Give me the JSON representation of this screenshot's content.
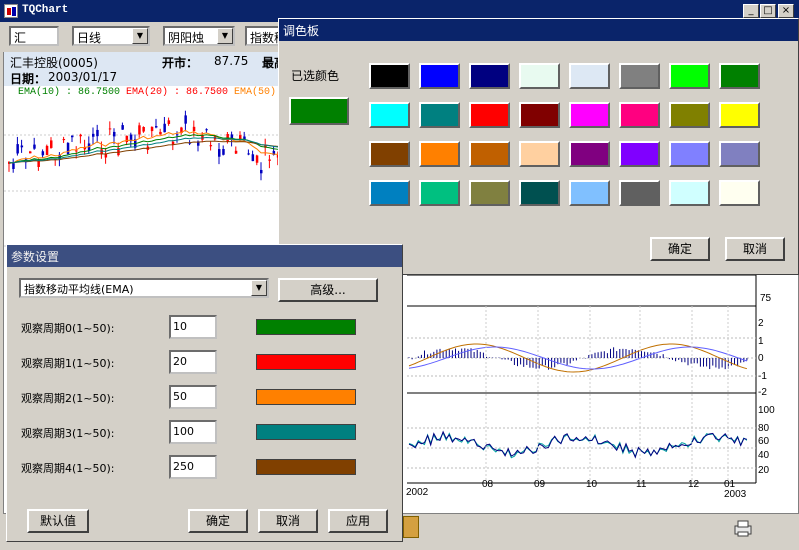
{
  "window": {
    "title": "TQChart",
    "min": "_",
    "max": "□",
    "close": "×"
  },
  "toolbar": {
    "code": "汇",
    "period": "日线",
    "style": "阴阳烛",
    "indicator": "指数移"
  },
  "info": {
    "stock": "汇丰控股(0005)",
    "open_label": "开市：",
    "open_value": "87.75",
    "high_label": "最高",
    "date_label": "日期：",
    "date_value": "2003/01/17",
    "ema10": "EMA(10) : 86.7500",
    "ema20": "EMA(20) : 86.7500",
    "ema50": "EMA(50)"
  },
  "axes": {
    "y_top_tick": "75",
    "macd_ticks": [
      "2",
      "1",
      "0",
      "-1",
      "-2"
    ],
    "osc_ticks": [
      "100",
      "80",
      "60",
      "40",
      "20"
    ],
    "x_labels": [
      "2002",
      "08",
      "09",
      "10",
      "11",
      "12",
      "01",
      "2003"
    ]
  },
  "palette": {
    "title": "调色板",
    "selected_label": "已选颜色",
    "selected_color": "#008000",
    "colors": [
      "#000000",
      "#0000ff",
      "#000080",
      "#e8faf0",
      "#dde8f4",
      "#808080",
      "#00ff00",
      "#008000",
      "#00ffff",
      "#008080",
      "#ff0000",
      "#800000",
      "#ff00ff",
      "#ff0080",
      "#808000",
      "#ffff00",
      "#804000",
      "#ff8000",
      "#c06000",
      "#ffd0a0",
      "#800080",
      "#8000ff",
      "#8080ff",
      "#8080c0",
      "#0080c0",
      "#00c080",
      "#808040",
      "#005050",
      "#80c0ff",
      "#606060",
      "#d0ffff",
      "#fffff0"
    ],
    "ok": "确定",
    "cancel": "取消"
  },
  "params": {
    "title": "参数设置",
    "indicator_select": "指数移动平均线(EMA)",
    "advanced": "高级...",
    "rows": [
      {
        "label": "观察周期0(1~50):",
        "value": "10",
        "color": "#008000"
      },
      {
        "label": "观察周期1(1~50):",
        "value": "20",
        "color": "#ff0000"
      },
      {
        "label": "观察周期2(1~50):",
        "value": "50",
        "color": "#ff8000"
      },
      {
        "label": "观察周期3(1~50):",
        "value": "100",
        "color": "#008080"
      },
      {
        "label": "观察周期4(1~50):",
        "value": "250",
        "color": "#804000"
      }
    ],
    "default": "默认值",
    "ok": "确定",
    "cancel": "取消",
    "apply": "应用"
  }
}
